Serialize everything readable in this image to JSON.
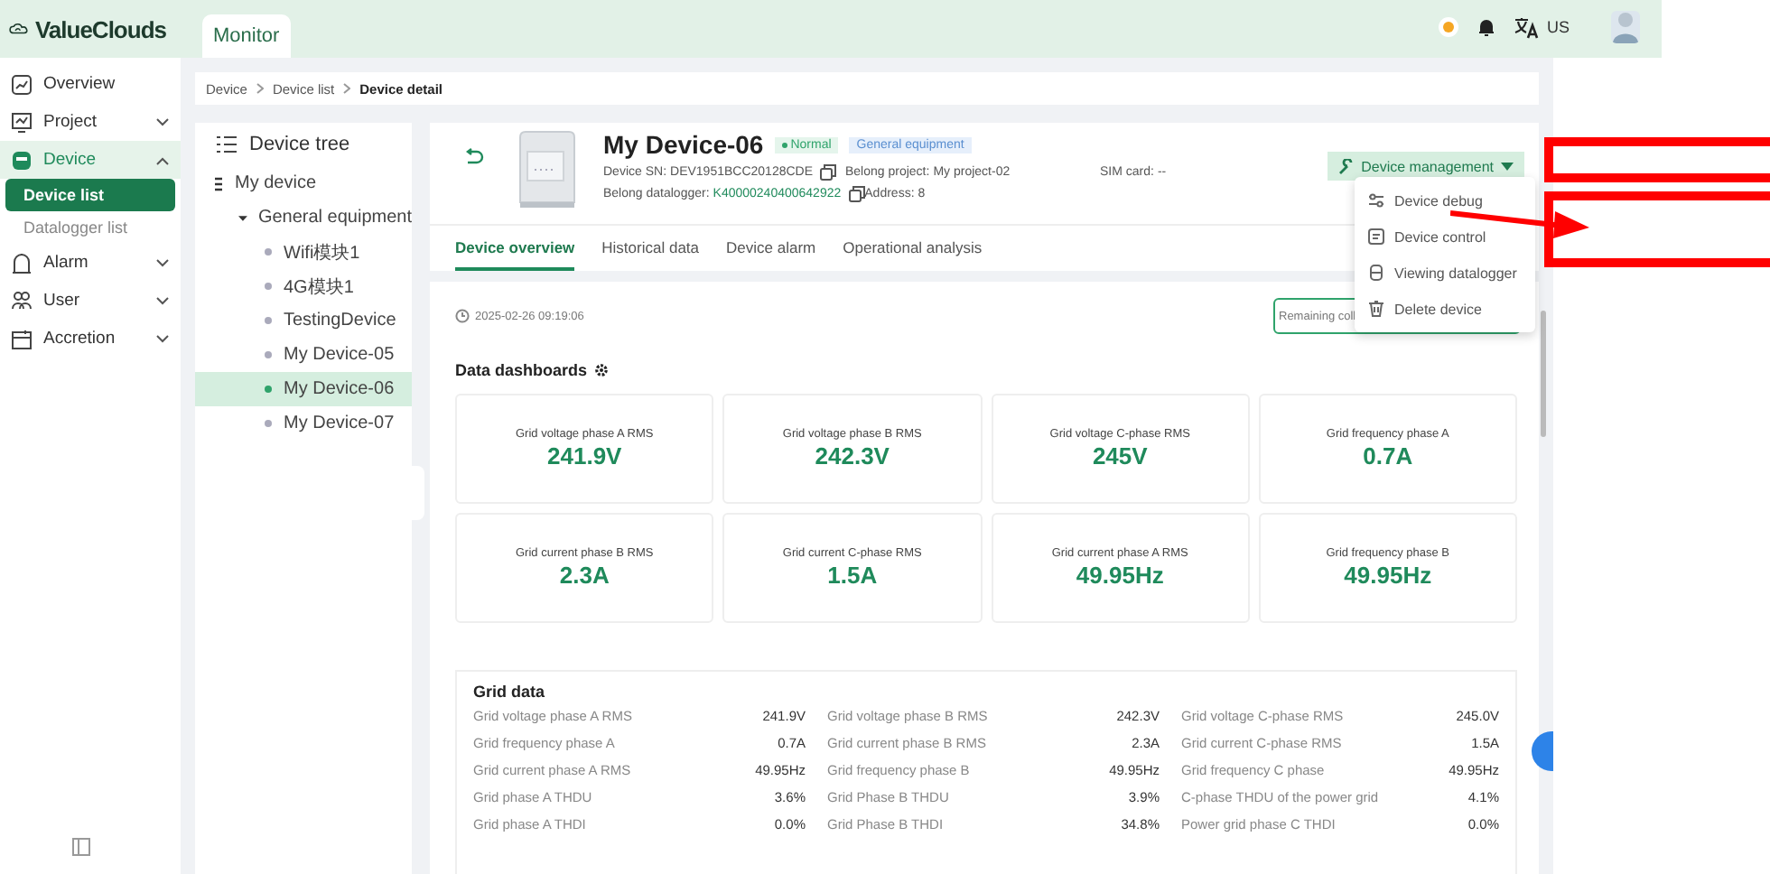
{
  "header": {
    "logo": "ValueClouds",
    "tabs": [
      {
        "label": "Monitor",
        "selected": true
      }
    ],
    "language": "US"
  },
  "sidebar": {
    "items": [
      {
        "label": "Overview",
        "kind": "link",
        "selected": false
      },
      {
        "label": "Project",
        "kind": "group",
        "expanded": false,
        "selected": false
      },
      {
        "label": "Device",
        "kind": "group",
        "expanded": true,
        "selected": true,
        "children": [
          {
            "label": "Device list",
            "selected": true
          },
          {
            "label": "Datalogger list",
            "selected": false
          }
        ]
      },
      {
        "label": "Alarm",
        "kind": "group",
        "expanded": false,
        "selected": false
      },
      {
        "label": "User",
        "kind": "group",
        "expanded": false,
        "selected": false
      },
      {
        "label": "Accretion",
        "kind": "group",
        "expanded": false,
        "selected": false
      }
    ]
  },
  "breadcrumb": [
    {
      "label": "Device",
      "current": false
    },
    {
      "label": "Device list",
      "current": false
    },
    {
      "label": "Device detail",
      "current": true
    }
  ],
  "device_tree": {
    "title": "Device tree",
    "nodes": [
      {
        "label": "My device",
        "expanded": true,
        "selected": false,
        "children": [
          {
            "label": "General equipment",
            "expanded": true,
            "selected": false,
            "children": [
              {
                "label": "Wifi模块1",
                "selected": false
              },
              {
                "label": "4G模块1",
                "selected": false
              },
              {
                "label": "TestingDevice",
                "selected": false
              },
              {
                "label": "My Device-05",
                "selected": false
              },
              {
                "label": "My Device-06",
                "selected": true
              },
              {
                "label": "My Device-07",
                "selected": false
              }
            ]
          }
        ]
      }
    ]
  },
  "device": {
    "name": "My Device-06",
    "status": "Normal",
    "type": "General equipment",
    "info_rows": [
      [
        {
          "label": "Device SN:",
          "value": "DEV1951BCC20128CDE",
          "copy": true,
          "link": false
        },
        {
          "label": "Belong project:",
          "value": "My project-02",
          "copy": false,
          "link": false
        },
        {
          "label": "SIM card:",
          "value": "--",
          "copy": false,
          "link": false
        }
      ],
      [
        {
          "label": "Belong datalogger:",
          "value": "K40000240400642922",
          "copy": true,
          "link": true
        },
        {
          "label": "Address:",
          "value": "8",
          "copy": false,
          "link": false
        }
      ]
    ],
    "management": {
      "label": "Device management",
      "menu": [
        "Device debug",
        "Device control",
        "Viewing datalogger",
        "Delete device"
      ]
    }
  },
  "tabs": [
    {
      "label": "Device overview",
      "selected": true
    },
    {
      "label": "Historical data",
      "selected": false
    },
    {
      "label": "Device alarm",
      "selected": false
    },
    {
      "label": "Operational analysis",
      "selected": false
    }
  ],
  "overview": {
    "timestamp": "2025-02-26 09:19:06",
    "remaining": "Remaining coll",
    "dashboard_title": "Data dashboards",
    "cards": [
      {
        "label": "Grid voltage phase A RMS",
        "value": "241.9V"
      },
      {
        "label": "Grid voltage phase B RMS",
        "value": "242.3V"
      },
      {
        "label": "Grid voltage C-phase RMS",
        "value": "245V"
      },
      {
        "label": "Grid frequency phase A",
        "value": "0.7A"
      },
      {
        "label": "Grid current phase B RMS",
        "value": "2.3A"
      },
      {
        "label": "Grid current C-phase RMS",
        "value": "1.5A"
      },
      {
        "label": "Grid current phase A RMS",
        "value": "49.95Hz"
      },
      {
        "label": "Grid frequency phase B",
        "value": "49.95Hz"
      }
    ],
    "grid_data": {
      "title": "Grid data",
      "items": [
        {
          "label": "Grid voltage phase A RMS",
          "value": "241.9V"
        },
        {
          "label": "Grid voltage phase B RMS",
          "value": "242.3V"
        },
        {
          "label": "Grid voltage C-phase RMS",
          "value": "245.0V"
        },
        {
          "label": "Grid frequency phase A",
          "value": "0.7A"
        },
        {
          "label": "Grid current phase B RMS",
          "value": "2.3A"
        },
        {
          "label": "Grid current C-phase RMS",
          "value": "1.5A"
        },
        {
          "label": "Grid current phase A RMS",
          "value": "49.95Hz"
        },
        {
          "label": "Grid frequency phase B",
          "value": "49.95Hz"
        },
        {
          "label": "Grid frequency C phase",
          "value": "49.95Hz"
        },
        {
          "label": "Grid phase A THDU",
          "value": "3.6%"
        },
        {
          "label": "Grid Phase B THDU",
          "value": "3.9%"
        },
        {
          "label": "C-phase THDU of the power grid",
          "value": "4.1%"
        },
        {
          "label": "Grid phase A THDI",
          "value": "0.0%"
        },
        {
          "label": "Grid Phase B THDI",
          "value": "34.8%"
        },
        {
          "label": "Power grid phase C THDI",
          "value": "0.0%"
        }
      ]
    }
  }
}
